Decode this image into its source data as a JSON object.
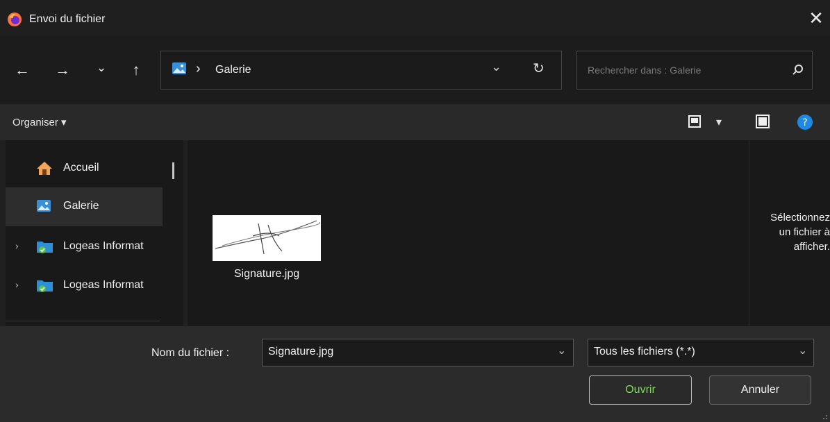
{
  "window": {
    "title": "Envoi du fichier",
    "close_glyph": "✕"
  },
  "nav": {
    "back_glyph": "←",
    "forward_glyph": "→",
    "recent_glyph": "⌄",
    "up_glyph": "↑",
    "breadcrumb_sep": "›",
    "path": "Galerie",
    "dropdown_glyph": "⌄",
    "refresh_glyph": "↻",
    "search_placeholder": "Rechercher dans : Galerie"
  },
  "toolbar": {
    "organiser_label": "Organiser ▾",
    "view_dropdown_glyph": "▾"
  },
  "sidebar": {
    "items": [
      {
        "label": "Accueil",
        "icon": "home-icon",
        "expandable": false,
        "selected": false
      },
      {
        "label": "Galerie",
        "icon": "gallery-icon",
        "expandable": false,
        "selected": true
      },
      {
        "label": "Logeas Informat",
        "icon": "folder-check-icon",
        "expandable": true,
        "selected": false
      },
      {
        "label": "Logeas Informat",
        "icon": "folder-check-icon",
        "expandable": true,
        "selected": false
      }
    ],
    "chevron_glyph": "›"
  },
  "files": [
    {
      "name": "Signature.jpg",
      "type": "image"
    }
  ],
  "preview": {
    "line1": "Sélectionnez",
    "line2": "un fichier à",
    "line3": "afficher."
  },
  "footer": {
    "filename_label": "Nom du fichier :",
    "filename_value": "Signature.jpg",
    "filter_value": "Tous les fichiers (*.*)",
    "dropdown_glyph": "⌄",
    "open_label": "Ouvrir",
    "cancel_label": "Annuler"
  },
  "colors": {
    "background": "#202020",
    "accent_help": "#1e88e5",
    "open_text": "#7ed957"
  }
}
